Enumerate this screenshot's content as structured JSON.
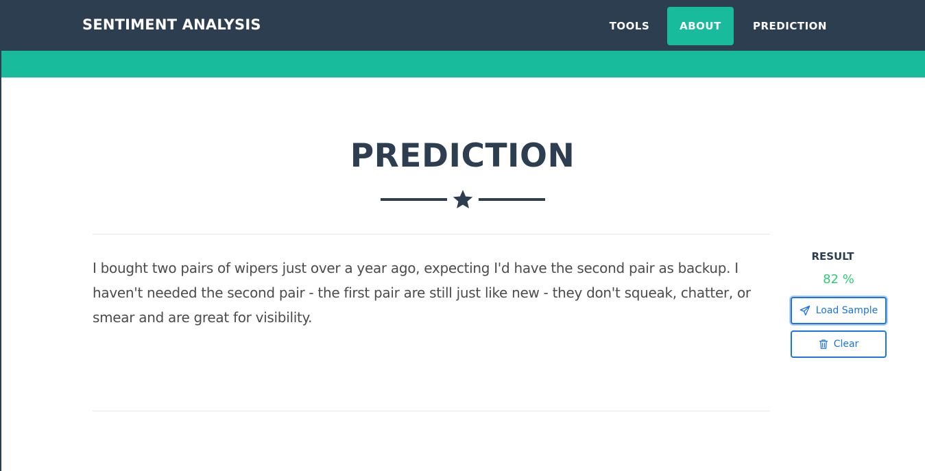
{
  "navbar": {
    "brand": "SENTIMENT ANALYSIS",
    "items": [
      {
        "label": "TOOLS",
        "active": false
      },
      {
        "label": "ABOUT",
        "active": true
      },
      {
        "label": "PREDICTION",
        "active": false
      }
    ]
  },
  "main": {
    "title": "PREDICTION",
    "divider_icon": "star-icon",
    "review_text": "I bought two pairs of wipers just over a year ago, expecting I'd have the second pair as backup. I haven't needed the second pair - the first pair are still just like new - they don't squeak, chatter, or smear and are great for visibility."
  },
  "result": {
    "label": "RESULT",
    "value": "82 %"
  },
  "buttons": {
    "load_sample": {
      "label": "Load Sample",
      "icon": "paper-plane-icon"
    },
    "clear": {
      "label": "Clear",
      "icon": "trash-icon"
    }
  },
  "colors": {
    "navbar_bg": "#2c3e50",
    "accent": "#18bc9c",
    "button_blue": "#1a73e8",
    "result_green": "#2ecc71"
  }
}
